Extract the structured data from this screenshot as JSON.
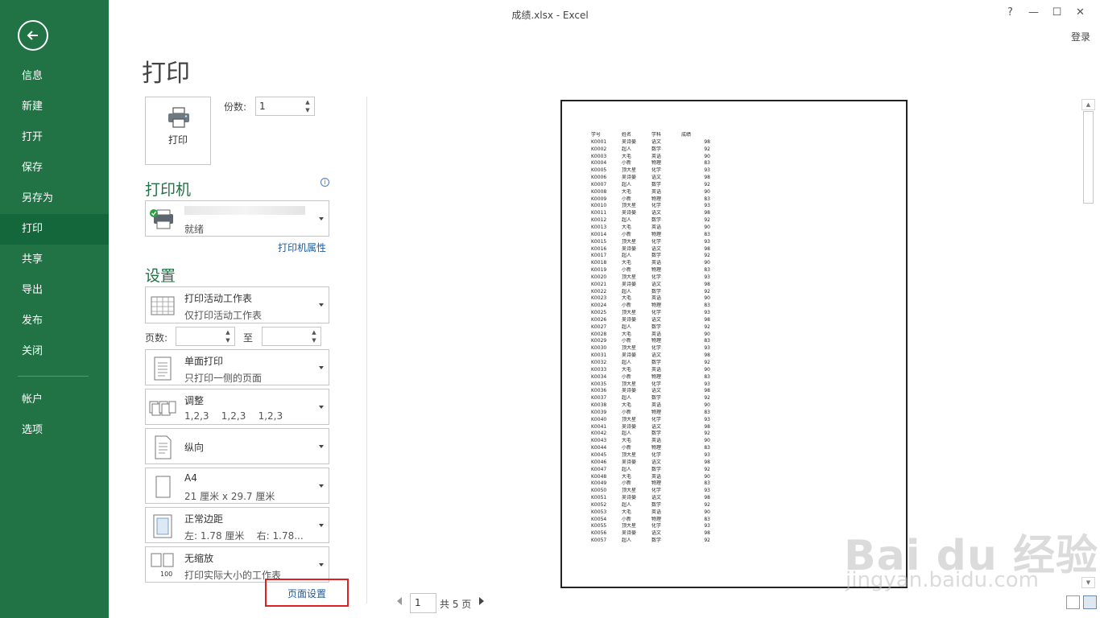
{
  "window": {
    "title": "成绩.xlsx - Excel",
    "help": "?",
    "minimize": "—",
    "maximize": "☐",
    "close": "✕",
    "login": "登录"
  },
  "sidebar": {
    "items": [
      {
        "label": "信息"
      },
      {
        "label": "新建"
      },
      {
        "label": "打开"
      },
      {
        "label": "保存"
      },
      {
        "label": "另存为"
      },
      {
        "label": "打印"
      },
      {
        "label": "共享"
      },
      {
        "label": "导出"
      },
      {
        "label": "发布"
      },
      {
        "label": "关闭"
      },
      {
        "label": "帐户"
      },
      {
        "label": "选项"
      }
    ],
    "active": "打印"
  },
  "print": {
    "heading": "打印",
    "button_label": "打印",
    "copies_label": "份数:",
    "copies_value": "1"
  },
  "printer": {
    "heading": "打印机",
    "info": "i",
    "status": "就绪",
    "properties": "打印机属性"
  },
  "settings": {
    "heading": "设置",
    "what": {
      "title": "打印活动工作表",
      "subtitle": "仅打印活动工作表"
    },
    "pages_label": "页数:",
    "to_label": "至",
    "sides": {
      "title": "单面打印",
      "subtitle": "只打印一侧的页面"
    },
    "collate": {
      "title": "调整",
      "subtitle": "1,2,3    1,2,3    1,2,3"
    },
    "orientation": {
      "title": "纵向"
    },
    "paper": {
      "title": "A4",
      "subtitle": "21 厘米 x 29.7 厘米"
    },
    "margins": {
      "title": "正常边距",
      "subtitle": "左: 1.78 厘米    右: 1.78..."
    },
    "scaling": {
      "title": "无缩放",
      "subtitle": "打印实际大小的工作表",
      "icon_text": "100"
    },
    "page_setup": "页面设置"
  },
  "preview": {
    "columns": [
      "学号",
      "姓名",
      "学科",
      "成绩"
    ],
    "rows": [
      [
        "K0001",
        "吴诗晏",
        "语文",
        "98"
      ],
      [
        "K0002",
        "超人",
        "数学",
        "92"
      ],
      [
        "K0003",
        "大毛",
        "英语",
        "90"
      ],
      [
        "K0004",
        "小新",
        "物理",
        "83"
      ],
      [
        "K0005",
        "顶大星",
        "化学",
        "93"
      ],
      [
        "K0006",
        "吴诗晏",
        "语文",
        "98"
      ],
      [
        "K0007",
        "超人",
        "数学",
        "92"
      ],
      [
        "K0008",
        "大毛",
        "英语",
        "90"
      ],
      [
        "K0009",
        "小新",
        "物理",
        "83"
      ],
      [
        "K0010",
        "顶大星",
        "化学",
        "93"
      ],
      [
        "K0011",
        "吴诗晏",
        "语文",
        "98"
      ],
      [
        "K0012",
        "超人",
        "数学",
        "92"
      ],
      [
        "K0013",
        "大毛",
        "英语",
        "90"
      ],
      [
        "K0014",
        "小新",
        "物理",
        "83"
      ],
      [
        "K0015",
        "顶大星",
        "化学",
        "93"
      ],
      [
        "K0016",
        "吴诗晏",
        "语文",
        "98"
      ],
      [
        "K0017",
        "超人",
        "数学",
        "92"
      ],
      [
        "K0018",
        "大毛",
        "英语",
        "90"
      ],
      [
        "K0019",
        "小新",
        "物理",
        "83"
      ],
      [
        "K0020",
        "顶大星",
        "化学",
        "93"
      ],
      [
        "K0021",
        "吴诗晏",
        "语文",
        "98"
      ],
      [
        "K0022",
        "超人",
        "数学",
        "92"
      ],
      [
        "K0023",
        "大毛",
        "英语",
        "90"
      ],
      [
        "K0024",
        "小新",
        "物理",
        "83"
      ],
      [
        "K0025",
        "顶大星",
        "化学",
        "93"
      ],
      [
        "K0026",
        "吴诗晏",
        "语文",
        "98"
      ],
      [
        "K0027",
        "超人",
        "数学",
        "92"
      ],
      [
        "K0028",
        "大毛",
        "英语",
        "90"
      ],
      [
        "K0029",
        "小新",
        "物理",
        "83"
      ],
      [
        "K0030",
        "顶大星",
        "化学",
        "93"
      ],
      [
        "K0031",
        "吴诗晏",
        "语文",
        "98"
      ],
      [
        "K0032",
        "超人",
        "数学",
        "92"
      ],
      [
        "K0033",
        "大毛",
        "英语",
        "90"
      ],
      [
        "K0034",
        "小新",
        "物理",
        "83"
      ],
      [
        "K0035",
        "顶大星",
        "化学",
        "93"
      ],
      [
        "K0036",
        "吴诗晏",
        "语文",
        "98"
      ],
      [
        "K0037",
        "超人",
        "数学",
        "92"
      ],
      [
        "K0038",
        "大毛",
        "英语",
        "90"
      ],
      [
        "K0039",
        "小新",
        "物理",
        "83"
      ],
      [
        "K0040",
        "顶大星",
        "化学",
        "93"
      ],
      [
        "K0041",
        "吴诗晏",
        "语文",
        "98"
      ],
      [
        "K0042",
        "超人",
        "数学",
        "92"
      ],
      [
        "K0043",
        "大毛",
        "英语",
        "90"
      ],
      [
        "K0044",
        "小新",
        "物理",
        "83"
      ],
      [
        "K0045",
        "顶大星",
        "化学",
        "93"
      ],
      [
        "K0046",
        "吴诗晏",
        "语文",
        "98"
      ],
      [
        "K0047",
        "超人",
        "数学",
        "92"
      ],
      [
        "K0048",
        "大毛",
        "英语",
        "90"
      ],
      [
        "K0049",
        "小新",
        "物理",
        "83"
      ],
      [
        "K0050",
        "顶大星",
        "化学",
        "93"
      ],
      [
        "K0051",
        "吴诗晏",
        "语文",
        "98"
      ],
      [
        "K0052",
        "超人",
        "数学",
        "92"
      ],
      [
        "K0053",
        "大毛",
        "英语",
        "90"
      ],
      [
        "K0054",
        "小新",
        "物理",
        "83"
      ],
      [
        "K0055",
        "顶大星",
        "化学",
        "93"
      ],
      [
        "K0056",
        "吴诗晏",
        "语文",
        "98"
      ],
      [
        "K0057",
        "超人",
        "数学",
        "92"
      ]
    ]
  },
  "pager": {
    "current": "1",
    "total": "共 5 页"
  },
  "watermark": {
    "brand": "Bai du 经验",
    "url": "jingyan.baidu.com"
  },
  "colors": {
    "sidebar": "#217346",
    "sidebar_active": "#13673a",
    "heading_green": "#217346",
    "link_blue": "#1e5b9e",
    "highlight_red": "#e02020"
  }
}
